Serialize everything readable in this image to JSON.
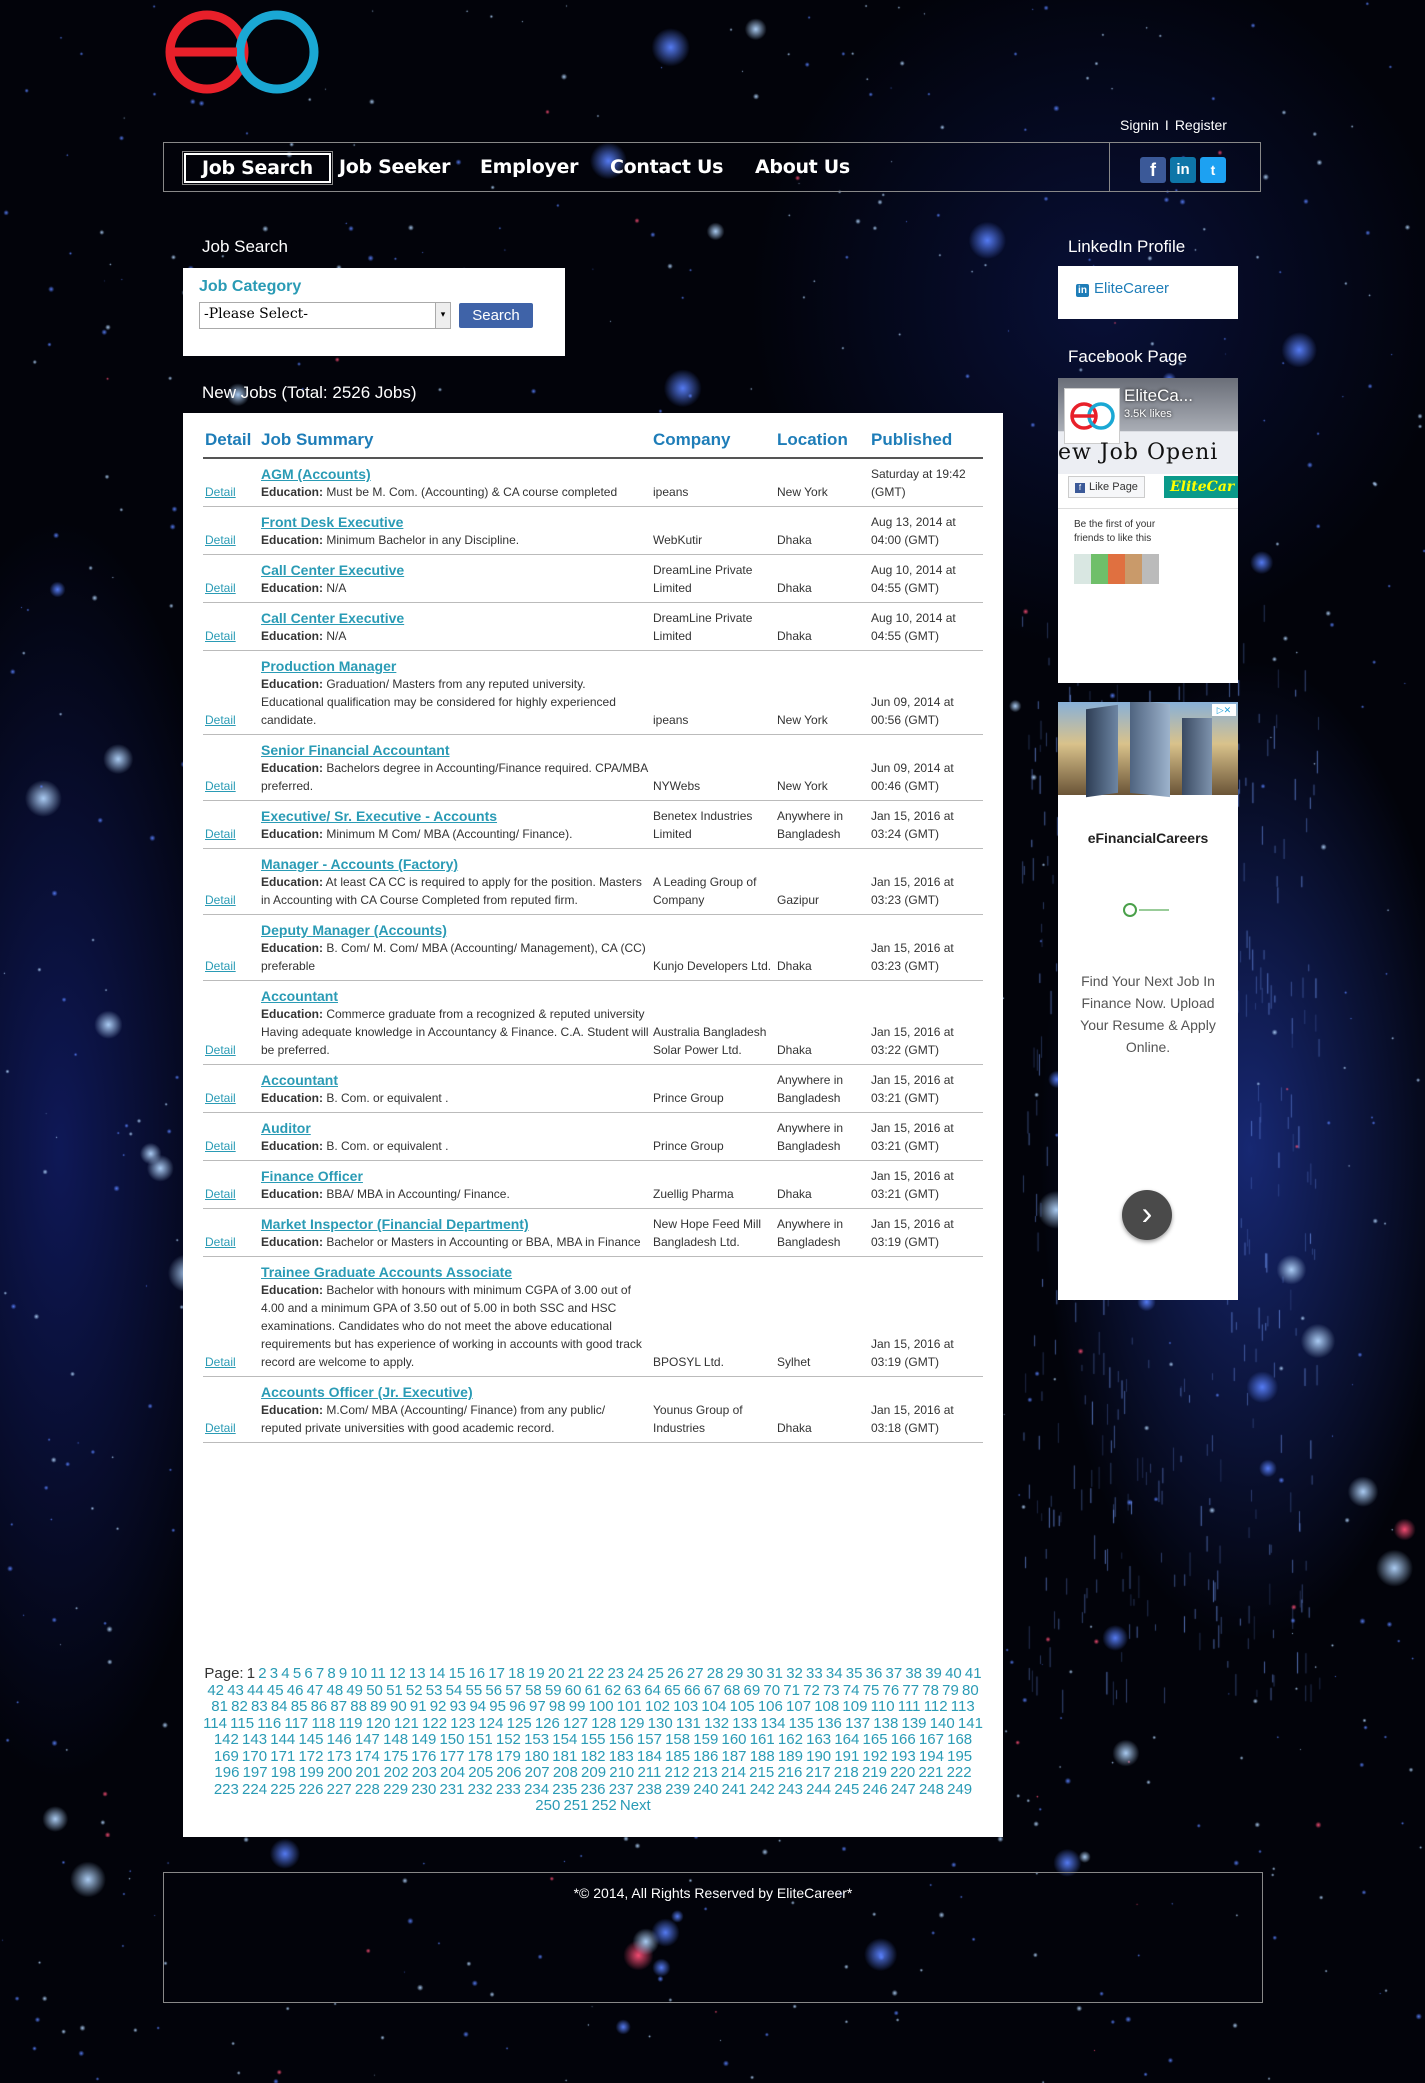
{
  "header": {
    "signin": "Signin",
    "separator": "I",
    "register": "Register"
  },
  "nav": {
    "items": [
      "Job Search",
      "Job Seeker",
      "Employer",
      "Contact Us",
      "About Us"
    ],
    "active": "Job Search",
    "social": [
      "facebook-icon",
      "linkedin-icon",
      "twitter-icon"
    ]
  },
  "search": {
    "section_title": "Job Search",
    "category_label": "Job Category",
    "select_value": "-Please Select-",
    "button": "Search"
  },
  "jobs": {
    "heading": "New Jobs (Total: 2526 Jobs)",
    "columns": [
      "Detail",
      "Job Summary",
      "Company",
      "Location",
      "Published"
    ],
    "education_label": "Education:",
    "detail_label": "Detail",
    "rows": [
      {
        "title": "AGM (Accounts)",
        "education": "Must be M. Com. (Accounting) & CA course completed",
        "company": "ipeans",
        "location": "New York",
        "published": "Saturday at 19:42 (GMT)"
      },
      {
        "title": "Front Desk Executive",
        "education": "Minimum Bachelor in any Discipline.",
        "company": "WebKutir",
        "location": "Dhaka",
        "published": "Aug 13, 2014 at 04:00 (GMT)"
      },
      {
        "title": "Call Center Executive",
        "education": "N/A",
        "company": "DreamLine Private Limited",
        "location": "Dhaka",
        "published": "Aug 10, 2014 at 04:55 (GMT)"
      },
      {
        "title": "Call Center Executive",
        "education": "N/A",
        "company": "DreamLine Private Limited",
        "location": "Dhaka",
        "published": "Aug 10, 2014 at 04:55 (GMT)"
      },
      {
        "title": "Production Manager",
        "education": "Graduation/ Masters from any reputed university. Educational qualification may be considered for highly experienced candidate.",
        "company": "ipeans",
        "location": "New York",
        "published": "Jun 09, 2014 at 00:56 (GMT)"
      },
      {
        "title": "Senior Financial Accountant",
        "education": "Bachelors degree in Accounting/Finance required. CPA/MBA preferred.",
        "company": "NYWebs",
        "location": "New York",
        "published": "Jun 09, 2014 at 00:46 (GMT)"
      },
      {
        "title": "Executive/ Sr. Executive - Accounts",
        "education": "Minimum M Com/ MBA (Accounting/ Finance).",
        "company": "Benetex Industries Limited",
        "location": "Anywhere in Bangladesh",
        "published": "Jan 15, 2016 at 03:24 (GMT)"
      },
      {
        "title": "Manager - Accounts (Factory)",
        "education": "At least CA CC is required to apply for the position. Masters in Accounting with CA Course Completed from reputed firm.",
        "company": "A Leading Group of Company",
        "location": "Gazipur",
        "published": "Jan 15, 2016 at 03:23 (GMT)"
      },
      {
        "title": "Deputy Manager (Accounts)",
        "education": "B. Com/ M. Com/ MBA (Accounting/ Management), CA (CC) preferable",
        "company": "Kunjo Developers Ltd.",
        "location": "Dhaka",
        "published": "Jan 15, 2016 at 03:23 (GMT)"
      },
      {
        "title": "Accountant",
        "education": "Commerce graduate from a recognized & reputed university Having adequate knowledge in Accountancy & Finance. C.A. Student will be preferred.",
        "company": "Australia Bangladesh Solar Power Ltd.",
        "location": "Dhaka",
        "published": "Jan 15, 2016 at 03:22 (GMT)"
      },
      {
        "title": "Accountant",
        "education": "B. Com. or equivalent .",
        "company": "Prince Group",
        "location": "Anywhere in Bangladesh",
        "published": "Jan 15, 2016 at 03:21 (GMT)"
      },
      {
        "title": "Auditor",
        "education": "B. Com. or equivalent .",
        "company": "Prince Group",
        "location": "Anywhere in Bangladesh",
        "published": "Jan 15, 2016 at 03:21 (GMT)"
      },
      {
        "title": "Finance Officer",
        "education": "BBA/ MBA in Accounting/ Finance.",
        "company": "Zuellig Pharma",
        "location": "Dhaka",
        "published": "Jan 15, 2016 at 03:21 (GMT)"
      },
      {
        "title": "Market Inspector (Financial Department)",
        "education": "Bachelor or Masters in Accounting or BBA, MBA in Finance",
        "company": "New Hope Feed Mill Bangladesh Ltd.",
        "location": "Anywhere in Bangladesh",
        "published": "Jan 15, 2016 at 03:19 (GMT)"
      },
      {
        "title": "Trainee Graduate Accounts Associate",
        "education": "Bachelor with honours with minimum CGPA of 3.00 out of 4.00 and a minimum GPA of 3.50 out of 5.00 in both SSC and HSC examinations. Candidates who do not meet the above educational requirements but has experience of working in accounts with good track record are welcome to apply.",
        "company": "BPOSYL Ltd.",
        "location": "Sylhet",
        "published": "Jan 15, 2016 at 03:19 (GMT)"
      },
      {
        "title": "Accounts Officer (Jr. Executive)",
        "education": "M.Com/ MBA (Accounting/ Finance) from any public/ reputed private universities with good academic record.",
        "company": "Younus Group of Industries",
        "location": "Dhaka",
        "published": "Jan 15, 2016 at 03:18 (GMT)"
      }
    ]
  },
  "pagination": {
    "label": "Page:",
    "current": 1,
    "last": 252,
    "next": "Next"
  },
  "sidebar": {
    "linkedin_title": "LinkedIn Profile",
    "linkedin_link": "EliteCareer",
    "facebook_title": "Facebook Page",
    "fb_page_name": "EliteCa...",
    "fb_likes": "3.5K likes",
    "fb_banner": "ew Job Openi",
    "fb_like_button": "Like Page",
    "fb_elite_button": "EliteCar",
    "fb_first": "Be the first of your friends to like this",
    "ad_title": "eFinancialCareers",
    "ad_text": "Find Your Next Job In Finance Now. Upload Your Resume & Apply Online."
  },
  "footer": {
    "text": "*© 2014, All Rights Reserved by EliteCareer*"
  },
  "colors": {
    "accent": "#2a9bb5",
    "header_blue": "#1e7db8",
    "logo_red": "#e8202a",
    "logo_cyan": "#1aa8d4",
    "search_button": "#3f63a8"
  }
}
